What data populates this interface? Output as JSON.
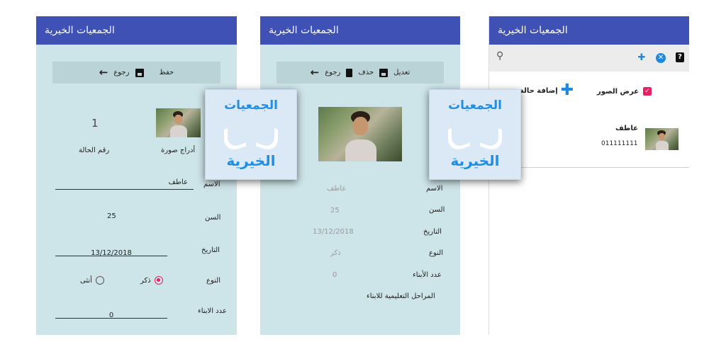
{
  "app_title": "الجمعيات الخيرية",
  "left": {
    "save_label": "حفظ",
    "back_label": "رجوع",
    "case_number_label": "رقم الحالة",
    "case_number_value": "1",
    "add_image_label": "أدراج صورة",
    "name_label": "الاسم",
    "name_value": "عاطف",
    "age_label": "السن",
    "age_value": "25",
    "date_label": "التاريخ",
    "date_value": "13/12/2018",
    "gender_label": "النوع",
    "male_label": "ذكر",
    "female_label": "أنثى",
    "selected_gender": "ذكر",
    "children_label": "عدد الابناء",
    "children_value": "0"
  },
  "middle": {
    "edit_label": "تعديل",
    "delete_label": "حذف",
    "back_label": "رجوع",
    "name_label": "الاسم",
    "name_value": "عاطف",
    "age_label": "السن",
    "age_value": "25",
    "date_label": "التاريخ",
    "date_value": "13/12/2018",
    "gender_label": "النوع",
    "gender_value": "ذكر",
    "children_label": "عدد الأبناء",
    "children_value": "0",
    "education_label": "المراحل التعليمية للابناء"
  },
  "right": {
    "show_images_label": "عرض الصور",
    "add_case_label": "إضافة حالة",
    "list": [
      {
        "name": "عاطف",
        "phone": "011111111"
      }
    ]
  },
  "logo": {
    "line1": "الجمعيات",
    "line2": "الخيرية"
  },
  "colors": {
    "appbar": "#3f51b5",
    "teal_bg": "#cde4e8",
    "accent_pink": "#e91e63",
    "logo_blue": "#1f8fe6"
  }
}
